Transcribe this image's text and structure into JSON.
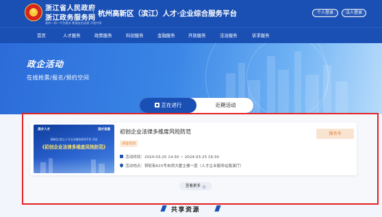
{
  "header": {
    "gov_line1": "浙江省人民政府",
    "gov_line2": "浙江政务服务网",
    "gov_line3": "政府一网一平台服务 数据自由流通 开放共享",
    "platform_title": "杭州高新区（滨江）人才·企业综合服务平台",
    "personal_login": "个人登录",
    "corporate_login": "法人登录"
  },
  "nav": {
    "items": [
      "首页",
      "人才服务",
      "政策服务",
      "科创服务",
      "金融服务",
      "开放服务",
      "法治服务",
      "诉求服务"
    ]
  },
  "banner": {
    "title": "政企活动",
    "subtitle": "在线抢票/报名/预约空间"
  },
  "tabs": {
    "ongoing": "正在进行",
    "recent": "近期活动"
  },
  "activity": {
    "thumb_logo_left": "滨才人才",
    "thumb_logo_right": "滨才发展",
    "thumb_small": "高新区(滨江)人才企业服务综合平台 活动",
    "thumb_big": "《初创企业法律多维度风险防范》",
    "title": "初创企业法律多维度风险防范",
    "tag": "讲座培训",
    "time": "活动时间：2024-03-25 14:30 ~ 2024-03-25 16:30",
    "location": "活动地点：铜轮街615号自贸大厦主楼一层（人才企业服务站路演厅）",
    "status_button": "报名中"
  },
  "more_button": "查看更多",
  "shared_resources": {
    "title": "共享资源"
  },
  "colors": {
    "primary": "#1a4fb4",
    "highlight_border": "#e52020",
    "status_bg": "#f9e4d2",
    "status_text": "#e07e38"
  }
}
